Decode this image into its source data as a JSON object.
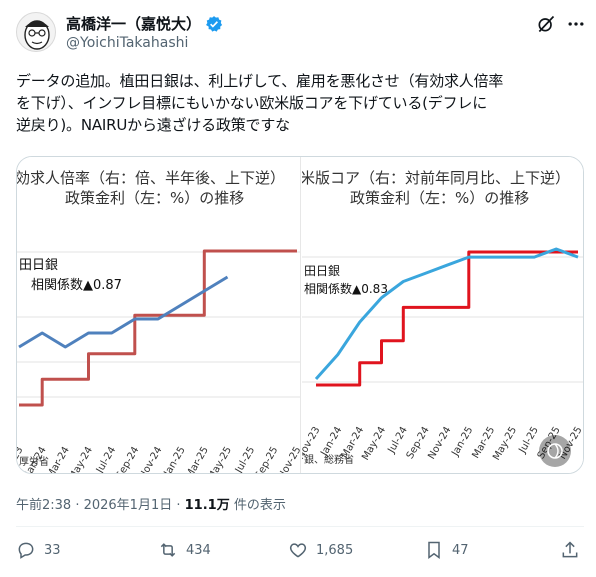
{
  "author": {
    "display_name": "高橋洋一（嘉悦大）",
    "handle": "@YoichiTakahashi"
  },
  "tweet": {
    "lines": [
      "データの追加。植田日銀は、利上げして、雇用を悪化させ（有効求人倍率",
      "を下げ）、インフレ目標にもいかない欧米版コアを下げている(デフレに",
      "逆戻り)。NAIRUから遠ざける政策ですな"
    ]
  },
  "media": {
    "left_chart": {
      "title_line1": "効求人倍率（右：倍、半年後、上下逆）",
      "title_line2": "政策金利（左：%）の推移",
      "annotation_title": "田日銀",
      "annotation_corr": "相関係数▲0.87",
      "source": "厚労省",
      "line_colors": {
        "policy_rate": "#c0504d",
        "job_ratio": "#4f81bd"
      }
    },
    "right_chart": {
      "title_line1": "米版コア（右：対前年同月比、上下逆）",
      "title_line2": "政策金利（左：%）の推移",
      "annotation_title": "田日銀",
      "annotation_corr": "相関係数▲0.83",
      "source": "銀、総務省",
      "line_colors": {
        "policy_rate": "#e0141e",
        "core_cpi": "#3aa6dd"
      }
    }
  },
  "chart_data": [
    {
      "type": "line",
      "title": "効求人倍率（右：倍、半年後、上下逆） 政策金利（左：%）の推移",
      "categories": [
        "Nov-23",
        "Jan-24",
        "Mar-24",
        "May-24",
        "Jul-24",
        "Sep-24",
        "Nov-24",
        "Jan-25",
        "Mar-25",
        "May-25",
        "Jul-25",
        "Sep-25",
        "Nov-25"
      ],
      "series": [
        {
          "name": "政策金利",
          "values": [
            -0.1,
            0.0,
            0.0,
            0.1,
            0.1,
            0.25,
            0.25,
            0.25,
            0.5,
            0.5,
            0.5,
            0.5,
            0.5
          ]
        },
        {
          "name": "有効求人倍率",
          "values": [
            1.27,
            1.26,
            1.27,
            1.26,
            1.26,
            1.25,
            1.25,
            1.24,
            1.23,
            1.22,
            null,
            null,
            null
          ]
        }
      ]
    },
    {
      "type": "line",
      "title": "米版コア（右：対前年同月比、上下逆） 政策金利（左：%）の推移",
      "categories": [
        "Nov-23",
        "Jan-24",
        "Mar-24",
        "May-24",
        "Jul-24",
        "Sep-24",
        "Nov-24",
        "Jan-25",
        "Mar-25",
        "May-25",
        "Jul-25",
        "Sep-25",
        "Nov-25"
      ],
      "series": [
        {
          "name": "政策金利",
          "values": [
            -0.1,
            -0.1,
            0.0,
            0.1,
            0.25,
            0.25,
            0.25,
            0.5,
            0.5,
            0.5,
            0.5,
            0.5,
            0.5
          ]
        },
        {
          "name": "欧米版コア",
          "values": [
            2.9,
            2.6,
            2.2,
            1.9,
            1.7,
            1.6,
            1.5,
            1.4,
            1.4,
            1.4,
            1.4,
            1.3,
            1.4
          ]
        }
      ]
    }
  ],
  "axis_labels": [
    "Nov-23",
    "Jan-24",
    "Mar-24",
    "May-24",
    "Jul-24",
    "Sep-24",
    "Nov-24",
    "Jan-25",
    "Mar-25",
    "May-25",
    "Jul-25",
    "Sep-25",
    "Nov-25"
  ],
  "meta": {
    "time": "午前2:38 · 2026年1月1日 · ",
    "views_count": "11.1万",
    "views_label": " 件の表示"
  },
  "actions": {
    "reply_count": "33",
    "repost_count": "434",
    "like_count": "1,685",
    "bookmark_count": "47"
  }
}
